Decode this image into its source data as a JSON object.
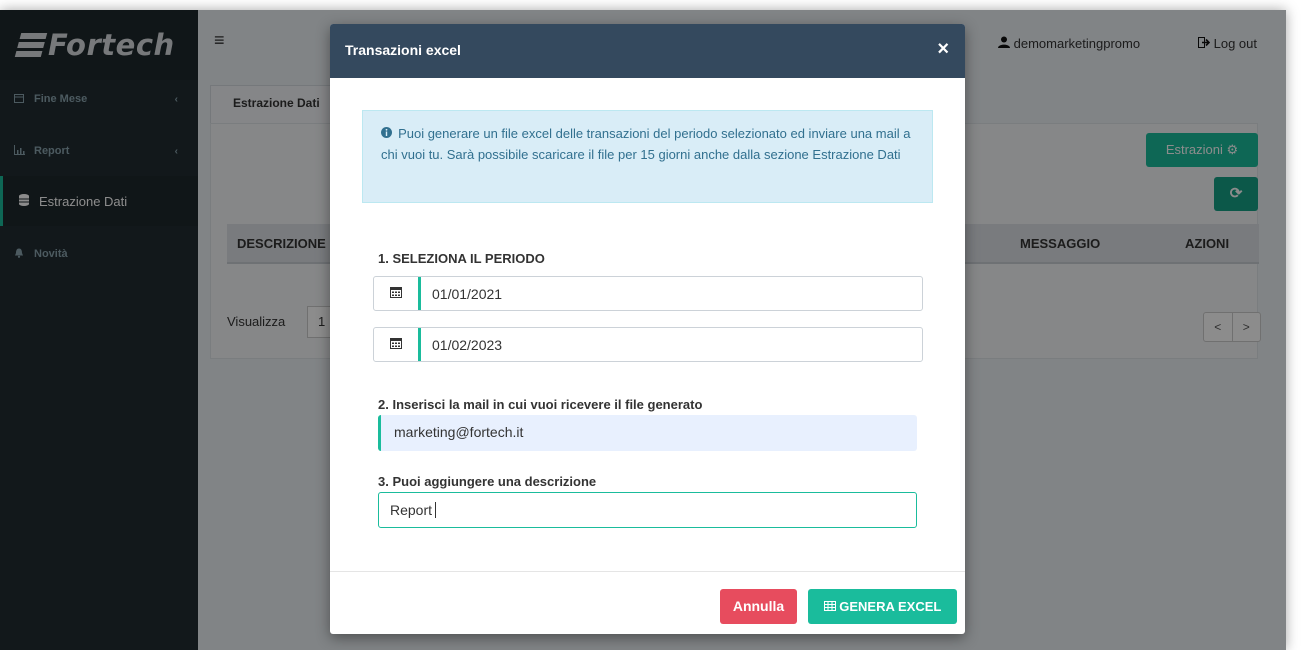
{
  "app": {
    "logo_text": "Fortech"
  },
  "sidebar": {
    "items": [
      {
        "icon": "calendar-icon",
        "label": "Fine Mese"
      },
      {
        "icon": "bar-chart-icon",
        "label": "Report"
      },
      {
        "icon": "database-icon",
        "label": "Estrazione Dati"
      },
      {
        "icon": "bell-icon",
        "label": "Novità"
      }
    ]
  },
  "header": {
    "menu_icon": "hamburger-icon",
    "user_name": "demomarketingpromo",
    "logout_label": "Log out"
  },
  "page": {
    "tab_label": "Estrazione Dati",
    "estrazioni_button": "Estrazioni",
    "table_headers": [
      "DESCRIZIONE",
      "MESSAGGIO",
      "AZIONI"
    ],
    "visualizza_label": "Visualizza",
    "page_size_partial": "1",
    "pager_prev": "<",
    "pager_next": ">"
  },
  "modal": {
    "title": "Transazioni excel",
    "close_symbol": "×",
    "info_text": "Puoi generare un file excel delle transazioni del periodo selezionato ed inviare una mail a chi vuoi tu. Sarà possibile scaricare il file per 15 giorni anche dalla sezione Estrazione Dati",
    "step1_label": "1. SELEZIONA IL PERIODO",
    "date_from": "01/01/2021",
    "date_to": "01/02/2023",
    "step2_label": "2. Inserisci la mail in cui vuoi ricevere il file generato",
    "email_value": "marketing@fortech.it",
    "step3_label": "3. Puoi aggiungere una descrizione",
    "description_value": "Report",
    "cancel_label": "Annulla",
    "generate_label": "GENERA EXCEL"
  },
  "colors": {
    "accent": "#1abc9c",
    "sidebar_bg": "#222d32",
    "modal_header": "#34495e",
    "danger": "#e74c5e"
  }
}
